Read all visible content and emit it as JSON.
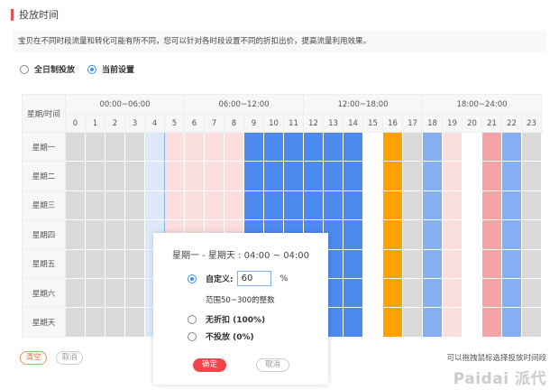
{
  "section_title": "投放时间",
  "tip": "宝贝在不同时段流量和转化可能有所不同，您可以针对各时段设置不同的折扣出价，提高流量利用效果。",
  "mode": {
    "options": [
      "全日制投放",
      "当前设置"
    ],
    "selected": 1
  },
  "grid": {
    "corner": "星期/时间",
    "ranges": [
      "00:00~06:00",
      "06:00~12:00",
      "12:00~18:00",
      "18:00~24:00"
    ],
    "hours": [
      "0",
      "1",
      "2",
      "3",
      "4",
      "5",
      "6",
      "7",
      "8",
      "9",
      "10",
      "11",
      "12",
      "13",
      "14",
      "15",
      "16",
      "17",
      "18",
      "19",
      "20",
      "21",
      "22",
      "23"
    ],
    "days": [
      "星期一",
      "星期二",
      "星期三",
      "星期四",
      "星期五",
      "星期六",
      "星期天"
    ],
    "hour_levels": [
      "gray",
      "gray",
      "gray",
      "gray",
      "selected",
      "pinklight",
      "pinklight",
      "pinklight",
      "pinklight",
      "blue",
      "blue",
      "blue",
      "blue",
      "blue",
      "blue",
      "white",
      "orange",
      "gray",
      "bluelight",
      "pinklight",
      "white",
      "pink",
      "bluelight",
      "gray"
    ],
    "colors": {
      "gray": "#d9d9d9",
      "selected": "#dce9fb",
      "pinklight": "#fbdede",
      "blue": "#4d8af0",
      "white": "#ffffff",
      "orange": "#ffa200",
      "bluelight": "#86aef2",
      "pink": "#f4a4a6"
    }
  },
  "popup": {
    "header": "星期一 - 星期天 : 04:00 ~ 04:00",
    "custom_label": "自定义:",
    "custom_value": "60",
    "percent": "%",
    "hint": "范围50~300的整数",
    "no_discount": "无折扣 (100%)",
    "no_delivery": "不投放 (0%)",
    "confirm": "确定",
    "cancel": "取消"
  },
  "clear": "清空",
  "cancel": "取消",
  "footer_tip": "可以拖拽鼠标选择投放时间段",
  "watermark": "Paidai 派代"
}
